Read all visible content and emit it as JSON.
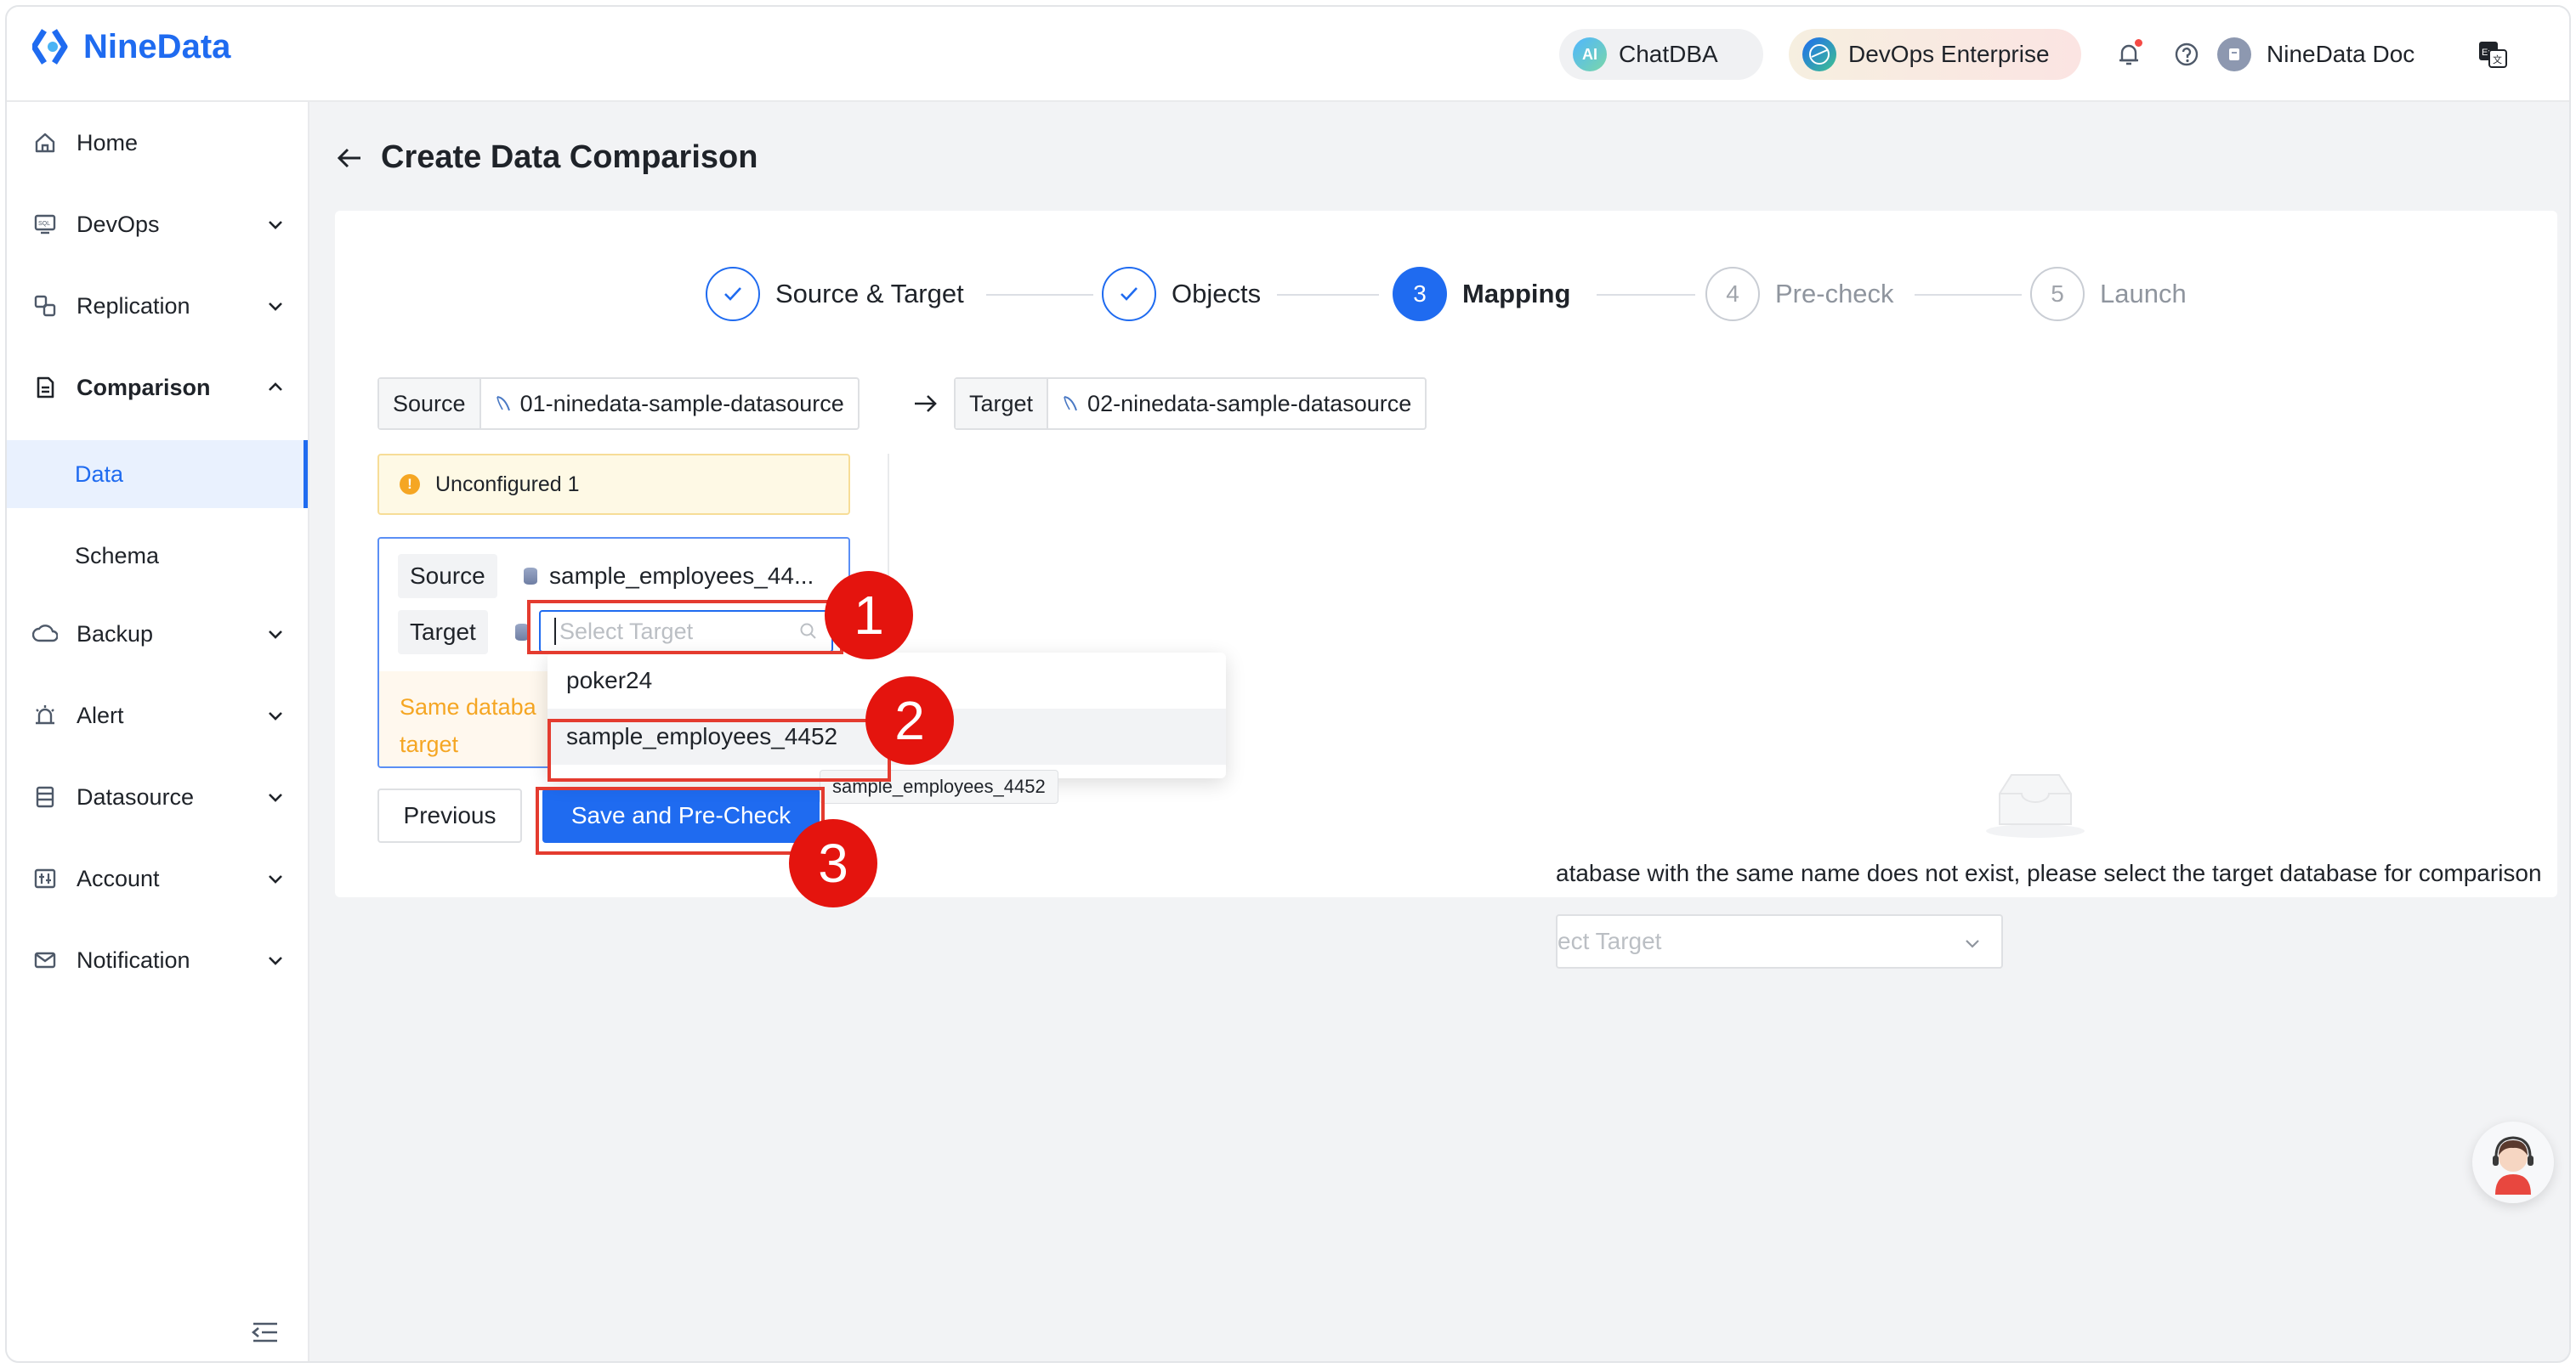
{
  "app": {
    "logo_text": "NineData"
  },
  "header": {
    "chatdba_label": "ChatDBA",
    "chatdba_icon_text": "AI",
    "devops_label": "DevOps Enterprise",
    "user_name": "NineData Doc"
  },
  "sidebar": {
    "items": [
      {
        "label": "Home",
        "icon": "home-icon"
      },
      {
        "label": "DevOps",
        "icon": "sql-icon"
      },
      {
        "label": "Replication",
        "icon": "replication-icon"
      },
      {
        "label": "Comparison",
        "icon": "comparison-icon",
        "expanded": true
      },
      {
        "label": "Backup",
        "icon": "backup-icon"
      },
      {
        "label": "Alert",
        "icon": "alert-icon"
      },
      {
        "label": "Datasource",
        "icon": "datasource-icon"
      },
      {
        "label": "Account",
        "icon": "account-icon"
      },
      {
        "label": "Notification",
        "icon": "mail-icon"
      }
    ],
    "sub_items": [
      {
        "label": "Data",
        "active": true
      },
      {
        "label": "Schema",
        "active": false
      }
    ]
  },
  "page": {
    "title": "Create Data Comparison"
  },
  "steps": [
    {
      "label": "Source & Target",
      "state": "done"
    },
    {
      "label": "Objects",
      "state": "done"
    },
    {
      "number": "3",
      "label": "Mapping",
      "state": "active"
    },
    {
      "number": "4",
      "label": "Pre-check",
      "state": "wait"
    },
    {
      "number": "5",
      "label": "Launch",
      "state": "wait"
    }
  ],
  "crumbs": {
    "source_label": "Source",
    "source_value": "01-ninedata-sample-datasource",
    "target_label": "Target",
    "target_value": "02-ninedata-sample-datasource"
  },
  "warning": {
    "text": "Unconfigured 1"
  },
  "mapping": {
    "source_label": "Source",
    "source_db": "sample_employees_44...",
    "target_label": "Target",
    "target_placeholder": "Select Target",
    "hint_line1": "Same databa",
    "hint_line2": "target"
  },
  "dropdown": {
    "options": [
      "poker24",
      "sample_employees_4452"
    ],
    "tooltip": "sample_employees_4452"
  },
  "buttons": {
    "previous": "Previous",
    "save": "Save and Pre-Check"
  },
  "empty_state": {
    "text": "atabase with the same name does not exist, please select the target database for comparison",
    "select_placeholder": "ect Target"
  },
  "annotations": [
    "1",
    "2",
    "3"
  ],
  "colors": {
    "primary": "#1f6bf0",
    "annotation_red": "#e4140e",
    "warning_bg": "#fef9e5"
  }
}
